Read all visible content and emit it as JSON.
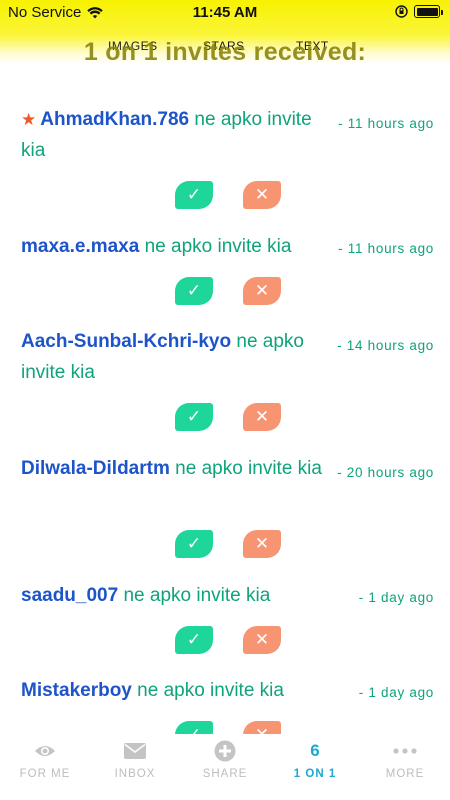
{
  "status_bar": {
    "carrier": "No Service",
    "time": "11:45 AM"
  },
  "top_tabs": [
    "IMAGES",
    "STARS",
    "TEXT"
  ],
  "page_title": "1 on 1 invites received:",
  "invites": [
    {
      "username": "AhmadKhan.786",
      "message": "ne apko invite kia",
      "time": "- 11 hours ago",
      "starred": true
    },
    {
      "username": "maxa.e.maxa",
      "message": "ne apko invite kia",
      "time": "- 11 hours ago",
      "starred": false
    },
    {
      "username": "Aach-Sunbal-Kchri-kyo",
      "message": "ne apko invite kia",
      "time": "- 14 hours ago",
      "starred": false
    },
    {
      "username": "Dilwala-Dildartm",
      "message": "ne apko invite kia",
      "time": "- 20 hours ago",
      "starred": false
    },
    {
      "username": "saadu_007",
      "message": "ne apko invite kia",
      "time": "- 1 day ago",
      "starred": false
    },
    {
      "username": "Mistakerboy",
      "message": "ne apko invite kia",
      "time": "- 1 day ago",
      "starred": false
    }
  ],
  "actions": {
    "accept_icon": "checkmark-icon",
    "reject_icon": "close-icon"
  },
  "tabbar": {
    "items": [
      {
        "label": "FOR ME",
        "icon": "eye-icon"
      },
      {
        "label": "INBOX",
        "icon": "envelope-icon"
      },
      {
        "label": "SHARE",
        "icon": "plus-circle-icon"
      },
      {
        "label": "1 ON 1",
        "count": "6",
        "active": true
      },
      {
        "label": "MORE",
        "icon": "more-dots-icon"
      }
    ]
  },
  "colors": {
    "header_yellow": "#f7f200",
    "username_blue": "#1d54c9",
    "message_green": "#0fa37c",
    "accept_green": "#1ed59a",
    "reject_orange": "#f79472",
    "star_orange": "#f05a28",
    "active_tab_blue": "#1ea7cf",
    "inactive_tab_gray": "#bdbdbd"
  }
}
